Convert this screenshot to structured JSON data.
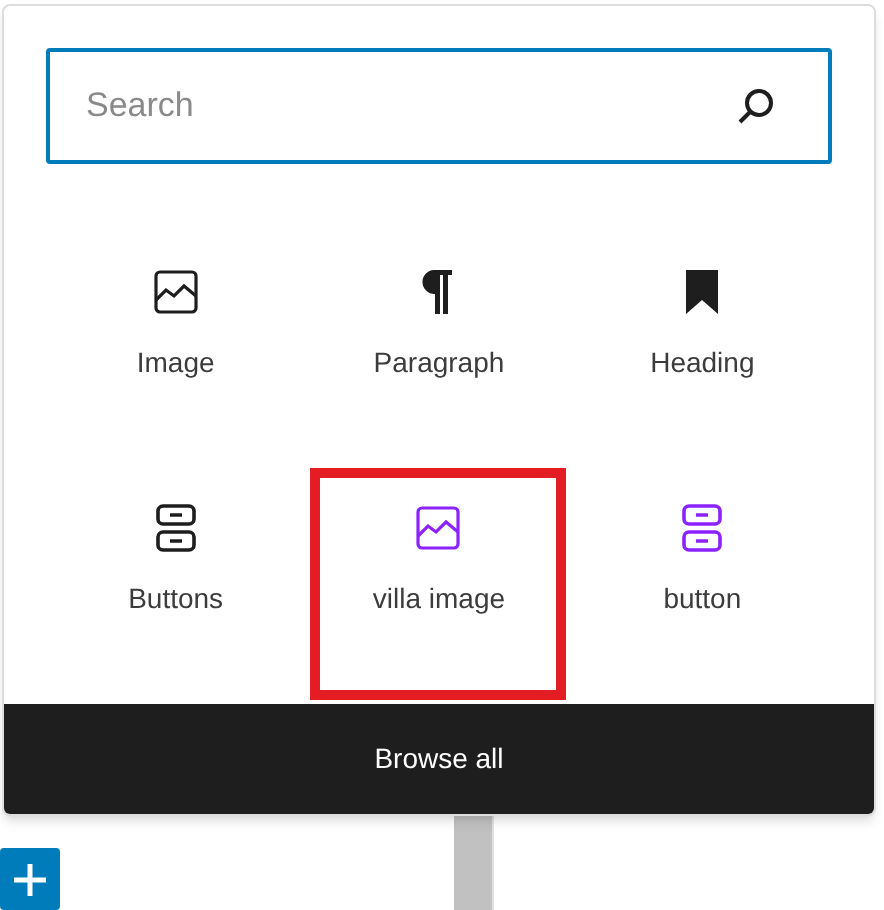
{
  "search": {
    "placeholder": "Search"
  },
  "blocks": [
    {
      "label": "Image",
      "kind": "image",
      "reusable": false,
      "highlighted": false
    },
    {
      "label": "Paragraph",
      "kind": "paragraph",
      "reusable": false,
      "highlighted": false
    },
    {
      "label": "Heading",
      "kind": "heading",
      "reusable": false,
      "highlighted": false
    },
    {
      "label": "Buttons",
      "kind": "buttons",
      "reusable": false,
      "highlighted": false
    },
    {
      "label": "villa image",
      "kind": "image",
      "reusable": true,
      "highlighted": true
    },
    {
      "label": "button",
      "kind": "buttons",
      "reusable": true,
      "highlighted": false
    }
  ],
  "browse_all": "Browse all"
}
